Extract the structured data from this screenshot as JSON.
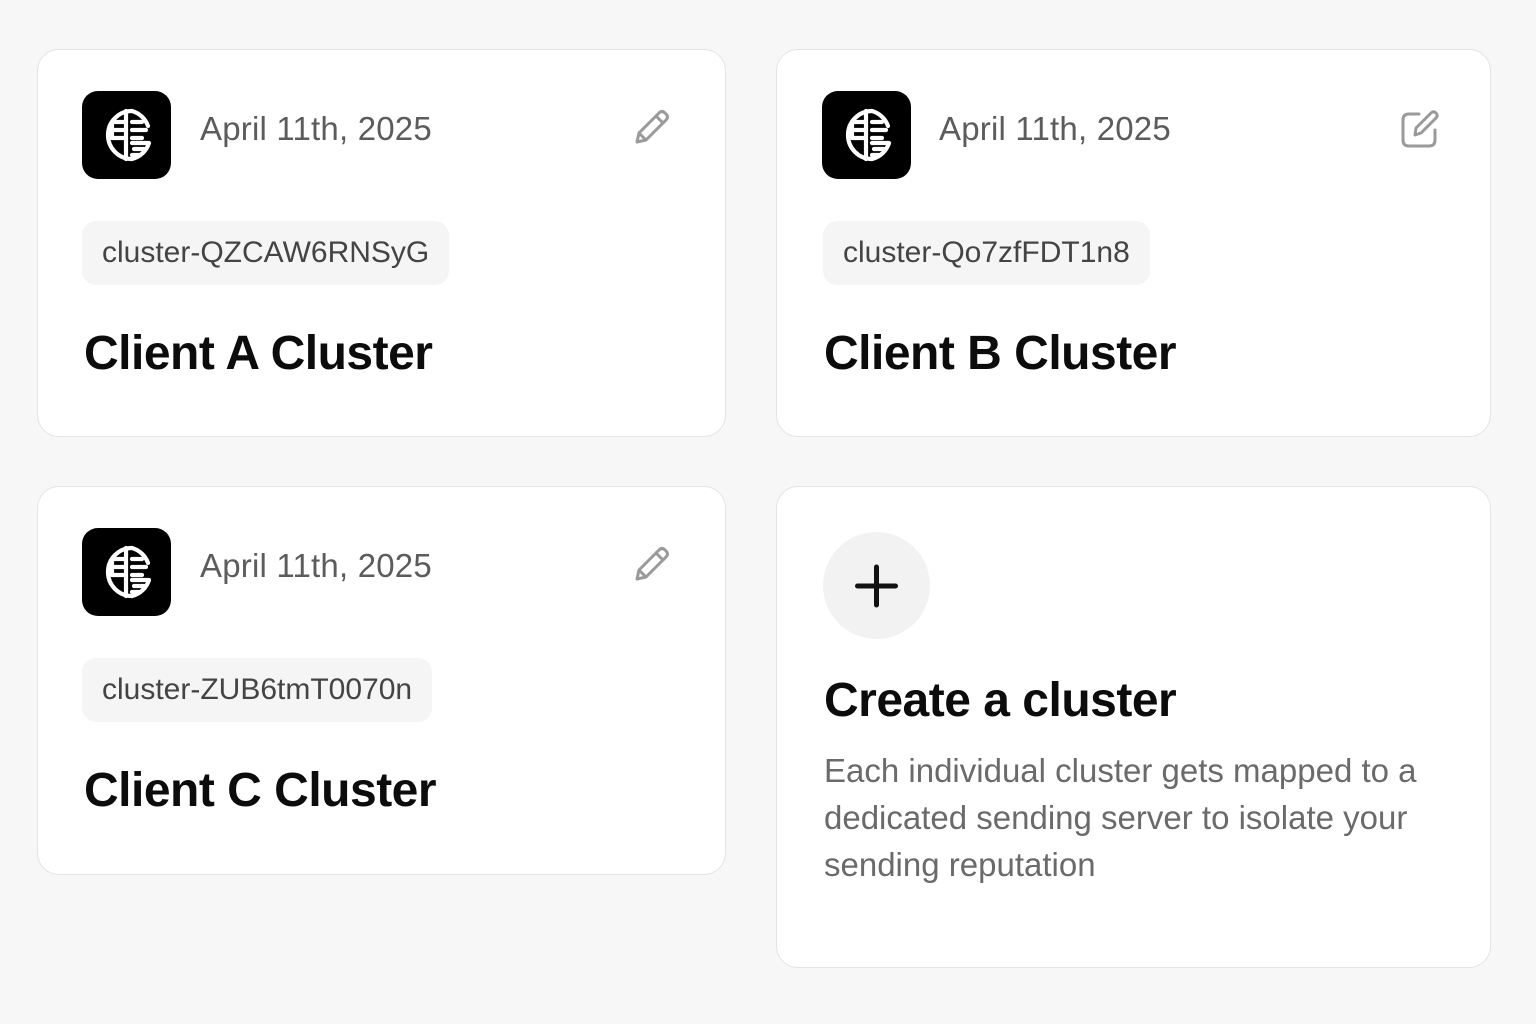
{
  "cards": [
    {
      "date": "April 11th, 2025",
      "cluster_id": "cluster-QZCAW6RNSyG",
      "name": "Client A Cluster",
      "logo_icon": "globe-grid-logo-icon",
      "edit_icon": "pencil-icon"
    },
    {
      "date": "April 11th, 2025",
      "cluster_id": "cluster-Qo7zfFDT1n8",
      "name": "Client B Cluster",
      "logo_icon": "globe-grid-logo-icon",
      "edit_icon": "edit-square-icon"
    },
    {
      "date": "April 11th, 2025",
      "cluster_id": "cluster-ZUB6tmT0070n",
      "name": "Client C Cluster",
      "logo_icon": "globe-grid-logo-icon",
      "edit_icon": "pencil-icon"
    }
  ],
  "create": {
    "title": "Create a cluster",
    "description": "Each individual cluster gets mapped to a dedicated sending server to isolate your sending reputation",
    "icon": "plus-icon"
  },
  "colors": {
    "background": "#f7f7f7",
    "card": "#ffffff",
    "logo_bg": "#000000",
    "chip_bg": "#f5f5f5",
    "icon_gray": "#9a9a9a"
  }
}
